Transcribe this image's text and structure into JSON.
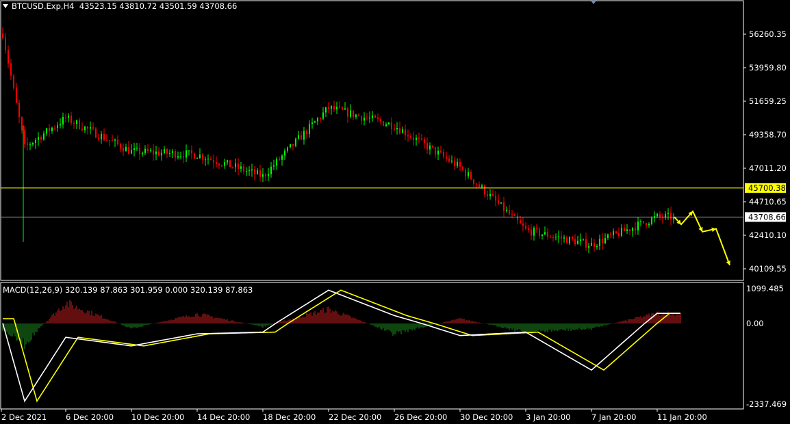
{
  "header": {
    "symbol": "BTCUSD.Exp,H4",
    "ohlc": "43523.15 43810.72 43501.59 43708.66"
  },
  "macd_header": {
    "text": "MACD(12,26,9) 320.139 87.863 301.959 0.000 320.139 87.863"
  },
  "colors": {
    "background": "#000000",
    "frame": "#ffffff",
    "bull_candle": "#00ff00",
    "bear_candle": "#ff0000",
    "hist_positive": "#c81e1e",
    "hist_negative": "#1e8c1e",
    "macd_line": "#ffffff",
    "signal_line": "#ffff00",
    "level_line": "#ffff00",
    "current_line": "#9a9a9a",
    "arrow": "#ffff00"
  },
  "chart_data": [
    {
      "type": "candlestick",
      "title": "BTCUSD.Exp,H4",
      "timeframe": "H4",
      "x": [
        "2 Dec 2021",
        "6 Dec 20:00",
        "10 Dec 20:00",
        "14 Dec 20:00",
        "18 Dec 20:00",
        "22 Dec 20:00",
        "26 Dec 20:00",
        "30 Dec 20:00",
        "3 Jan 20:00",
        "7 Jan 20:00",
        "11 Jan 20:00"
      ],
      "y_ticks": [
        "56260.35",
        "53959.80",
        "51659.25",
        "49358.70",
        "47011.20",
        "44710.65",
        "42410.10",
        "40109.55"
      ],
      "ylim": [
        39500,
        58000
      ],
      "approx_close_path": [
        {
          "x": "2 Dec 2021",
          "y": 56800
        },
        {
          "x": "4 Dec 2021",
          "y": 48500
        },
        {
          "x": "6 Dec 20:00",
          "y": 50500
        },
        {
          "x": "10 Dec 20:00",
          "y": 48200
        },
        {
          "x": "14 Dec 20:00",
          "y": 48000
        },
        {
          "x": "18 Dec 20:00",
          "y": 46500
        },
        {
          "x": "22 Dec 20:00",
          "y": 51200
        },
        {
          "x": "26 Dec 20:00",
          "y": 50000
        },
        {
          "x": "30 Dec 20:00",
          "y": 47100
        },
        {
          "x": "3 Jan 20:00",
          "y": 42800
        },
        {
          "x": "7 Jan 20:00",
          "y": 41800
        },
        {
          "x": "11 Jan 20:00",
          "y": 43708.66
        }
      ],
      "levels": [
        {
          "value": 45700.38,
          "label": "45700.38",
          "style": "yellow"
        },
        {
          "value": 43708.66,
          "label": "43708.66",
          "style": "current"
        }
      ],
      "projection": [
        43708.66,
        43200,
        44100,
        42700,
        42900,
        40400
      ]
    },
    {
      "type": "macd",
      "title": "MACD(12,26,9)",
      "y_ticks": [
        "1099.485",
        "0.00",
        "-2337.469"
      ],
      "ylim": [
        -2337.469,
        1099.485
      ],
      "values": {
        "macd": 320.139,
        "signal": 87.863
      },
      "approx_macd_path": [
        {
          "x": "2 Dec 2021",
          "y": 150
        },
        {
          "x": "4 Dec 2021",
          "y": -2250
        },
        {
          "x": "6 Dec 20:00",
          "y": -400
        },
        {
          "x": "10 Dec 20:00",
          "y": -650
        },
        {
          "x": "14 Dec 20:00",
          "y": -300
        },
        {
          "x": "18 Dec 20:00",
          "y": -250
        },
        {
          "x": "22 Dec 20:00",
          "y": 1050
        },
        {
          "x": "26 Dec 20:00",
          "y": 250
        },
        {
          "x": "30 Dec 20:00",
          "y": -350
        },
        {
          "x": "3 Jan 20:00",
          "y": -250
        },
        {
          "x": "7 Jan 20:00",
          "y": -1350
        },
        {
          "x": "11 Jan 20:00",
          "y": 320
        }
      ]
    }
  ]
}
